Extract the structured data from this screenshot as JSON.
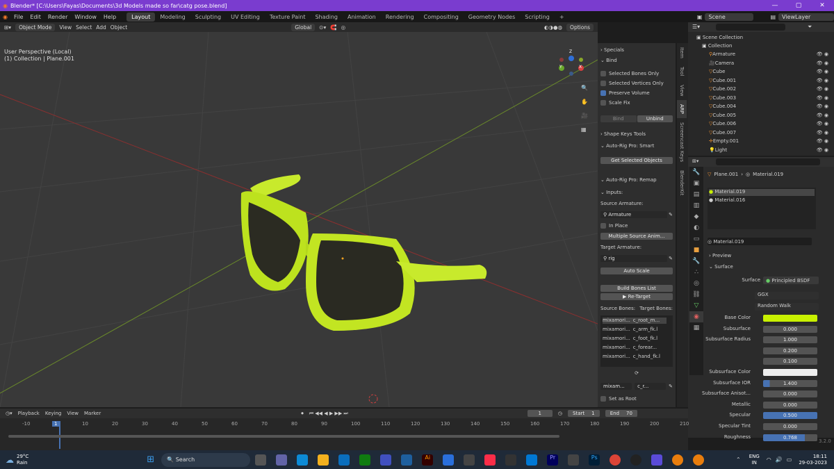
{
  "title": "Blender* [C:\\Users\\Fayas\\Documents\\3d Models made so far\\catg pose.blend]",
  "window_controls": [
    "—",
    "▢",
    "✕"
  ],
  "menu": [
    "File",
    "Edit",
    "Render",
    "Window",
    "Help"
  ],
  "workspaces": [
    "Layout",
    "Modeling",
    "Sculpting",
    "UV Editing",
    "Texture Paint",
    "Shading",
    "Animation",
    "Rendering",
    "Compositing",
    "Geometry Nodes",
    "Scripting"
  ],
  "active_workspace": "Layout",
  "scene": "Scene",
  "view_layer": "ViewLayer",
  "viewport_header": {
    "mode": "Object Mode",
    "view": "View",
    "select": "Select",
    "add": "Add",
    "object": "Object",
    "orientation": "Global",
    "options": "Options"
  },
  "viewport_info": {
    "line1": "User Perspective (Local)",
    "line2": "(1) Collection | Plane.001"
  },
  "gizmo": {
    "x": "X",
    "y": "Y",
    "z": "Z"
  },
  "npanel": {
    "specials": "Specials",
    "bind": "Bind",
    "selected_bones_only": "Selected Bones Only",
    "selected_vertices_only": "Selected Vertices Only",
    "preserve_volume": "Preserve Volume",
    "scale_fix": "Scale Fix",
    "bind_btn": "Bind",
    "unbind_btn": "Unbind",
    "shape_keys_tools": "Shape Keys Tools",
    "smart": "Auto-Rig Pro: Smart",
    "get_selected": "Get Selected Objects",
    "remap": "Auto-Rig Pro: Remap",
    "inputs": "Inputs:",
    "source_armature_label": "Source Armature:",
    "source_armature": "Armature",
    "in_place": "In Place",
    "multiple_source": "Multiple Source Anim...",
    "target_armature_label": "Target Armature:",
    "target_armature": "rig",
    "auto_scale": "Auto Scale",
    "build_bones": "Build Bones List",
    "retarget": "Re-Target",
    "source_bones": "Source Bones:",
    "target_bones": "Target Bones:",
    "bone_pairs": [
      [
        "mixamori...",
        "c_root_m..."
      ],
      [
        "mixamori...",
        "c_arm_fk.l"
      ],
      [
        "mixamori...",
        "c_foot_fk.l"
      ],
      [
        "mixamori...",
        "c_forear..."
      ],
      [
        "mixamori...",
        "c_hand_fk.l"
      ]
    ],
    "pair_src": "mixam...",
    "pair_tgt": "c_r...",
    "set_as_root": "Set as Root"
  },
  "ntabs": [
    "Item",
    "Tool",
    "View",
    "ARP",
    "Screencast Keys",
    "BlenderKit"
  ],
  "outliner": {
    "scene_collection": "Scene Collection",
    "collection": "Collection",
    "items": [
      "Armature",
      "Camera",
      "Cube",
      "Cube.001",
      "Cube.002",
      "Cube.003",
      "Cube.004",
      "Cube.005",
      "Cube.006",
      "Cube.007",
      "Empty.001",
      "Light"
    ]
  },
  "properties": {
    "object": "Plane.001",
    "material": "Material.019",
    "slots": [
      "Material.019",
      "Material.016"
    ],
    "material_name": "Material.019",
    "preview": "Preview",
    "surface_section": "Surface",
    "surface_label": "Surface",
    "surface_value": "Principled BSDF",
    "distribution": "GGX",
    "sss_method": "Random Walk",
    "fields": [
      {
        "label": "Base Color",
        "value": ""
      },
      {
        "label": "Subsurface",
        "value": "0.000"
      },
      {
        "label": "Subsurface Radius",
        "value": "1.000"
      },
      {
        "label": "",
        "value": "0.200"
      },
      {
        "label": "",
        "value": "0.100"
      },
      {
        "label": "Subsurface Color",
        "value": ""
      },
      {
        "label": "Subsurface IOR",
        "value": "1.400"
      },
      {
        "label": "Subsurface Anisot...",
        "value": "0.000"
      },
      {
        "label": "Metallic",
        "value": "0.000"
      },
      {
        "label": "Specular",
        "value": "0.500"
      },
      {
        "label": "Specular Tint",
        "value": "0.000"
      },
      {
        "label": "Roughness",
        "value": "0.768"
      }
    ],
    "base_color": "#c8f000"
  },
  "timeline": {
    "playback": "Playback",
    "keying": "Keying",
    "view": "View",
    "marker": "Marker",
    "current_frame": "1",
    "start_label": "Start",
    "start": "1",
    "end_label": "End",
    "end": "70",
    "ticks": [
      "-10",
      "1",
      "10",
      "20",
      "30",
      "40",
      "50",
      "60",
      "70",
      "80",
      "90",
      "100",
      "110",
      "120",
      "130",
      "140",
      "150",
      "160",
      "170",
      "180",
      "190",
      "200",
      "210"
    ]
  },
  "version": "3.2.0",
  "taskbar": {
    "temp": "29°C",
    "weather": "Rain",
    "search": "Search",
    "lang1": "ENG",
    "lang2": "IN",
    "time": "18:11",
    "date": "29-03-2023"
  }
}
